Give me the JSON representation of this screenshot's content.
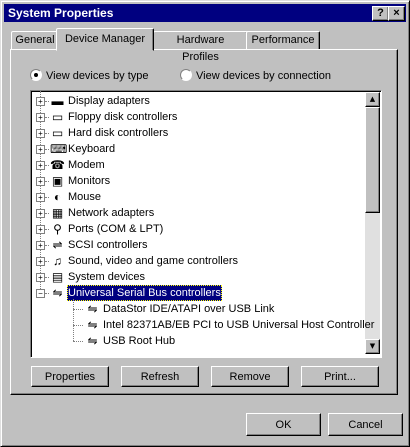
{
  "window": {
    "title": "System Properties",
    "help_label": "?",
    "close_label": "×"
  },
  "tabs": [
    {
      "label": "General",
      "active": false
    },
    {
      "label": "Device Manager",
      "active": true
    },
    {
      "label": "Hardware Profiles",
      "active": false
    },
    {
      "label": "Performance",
      "active": false
    }
  ],
  "view_options": {
    "by_type_label": "View devices by type",
    "by_connection_label": "View devices by connection",
    "selected": "by_type"
  },
  "tree": {
    "categories": [
      {
        "label": "Display adapters",
        "icon": "display-adapter-icon",
        "glyph": "▬"
      },
      {
        "label": "Floppy disk controllers",
        "icon": "floppy-controller-icon",
        "glyph": "▭"
      },
      {
        "label": "Hard disk controllers",
        "icon": "hard-disk-controller-icon",
        "glyph": "▭"
      },
      {
        "label": "Keyboard",
        "icon": "keyboard-icon",
        "glyph": "⌨"
      },
      {
        "label": "Modem",
        "icon": "modem-icon",
        "glyph": "☎"
      },
      {
        "label": "Monitors",
        "icon": "monitor-icon",
        "glyph": "▣"
      },
      {
        "label": "Mouse",
        "icon": "mouse-icon",
        "glyph": "◐"
      },
      {
        "label": "Network adapters",
        "icon": "network-adapter-icon",
        "glyph": "▦"
      },
      {
        "label": "Ports (COM & LPT)",
        "icon": "port-icon",
        "glyph": "⚲"
      },
      {
        "label": "SCSI controllers",
        "icon": "scsi-controller-icon",
        "glyph": "⇌"
      },
      {
        "label": "Sound, video and game controllers",
        "icon": "sound-controller-icon",
        "glyph": "♫"
      },
      {
        "label": "System devices",
        "icon": "system-devices-icon",
        "glyph": "▤"
      },
      {
        "label": "Universal Serial Bus controllers",
        "icon": "usb-controller-icon",
        "glyph": "⇋",
        "expanded": true,
        "selected": true
      }
    ],
    "usb_children": [
      {
        "label": "DataStor IDE/ATAPI over USB Link",
        "icon": "usb-device-icon",
        "glyph": "⇋"
      },
      {
        "label": "Intel 82371AB/EB PCI to USB Universal Host Controller",
        "icon": "usb-device-icon",
        "glyph": "⇋"
      },
      {
        "label": "USB Root Hub",
        "icon": "usb-device-icon",
        "glyph": "⇋"
      }
    ],
    "expand_glyph": "+",
    "collapse_glyph": "−"
  },
  "buttons": {
    "properties": "Properties",
    "refresh": "Refresh",
    "remove": "Remove",
    "print": "Print...",
    "ok": "OK",
    "cancel": "Cancel"
  },
  "scrollbar": {
    "up_glyph": "▲",
    "down_glyph": "▼"
  }
}
